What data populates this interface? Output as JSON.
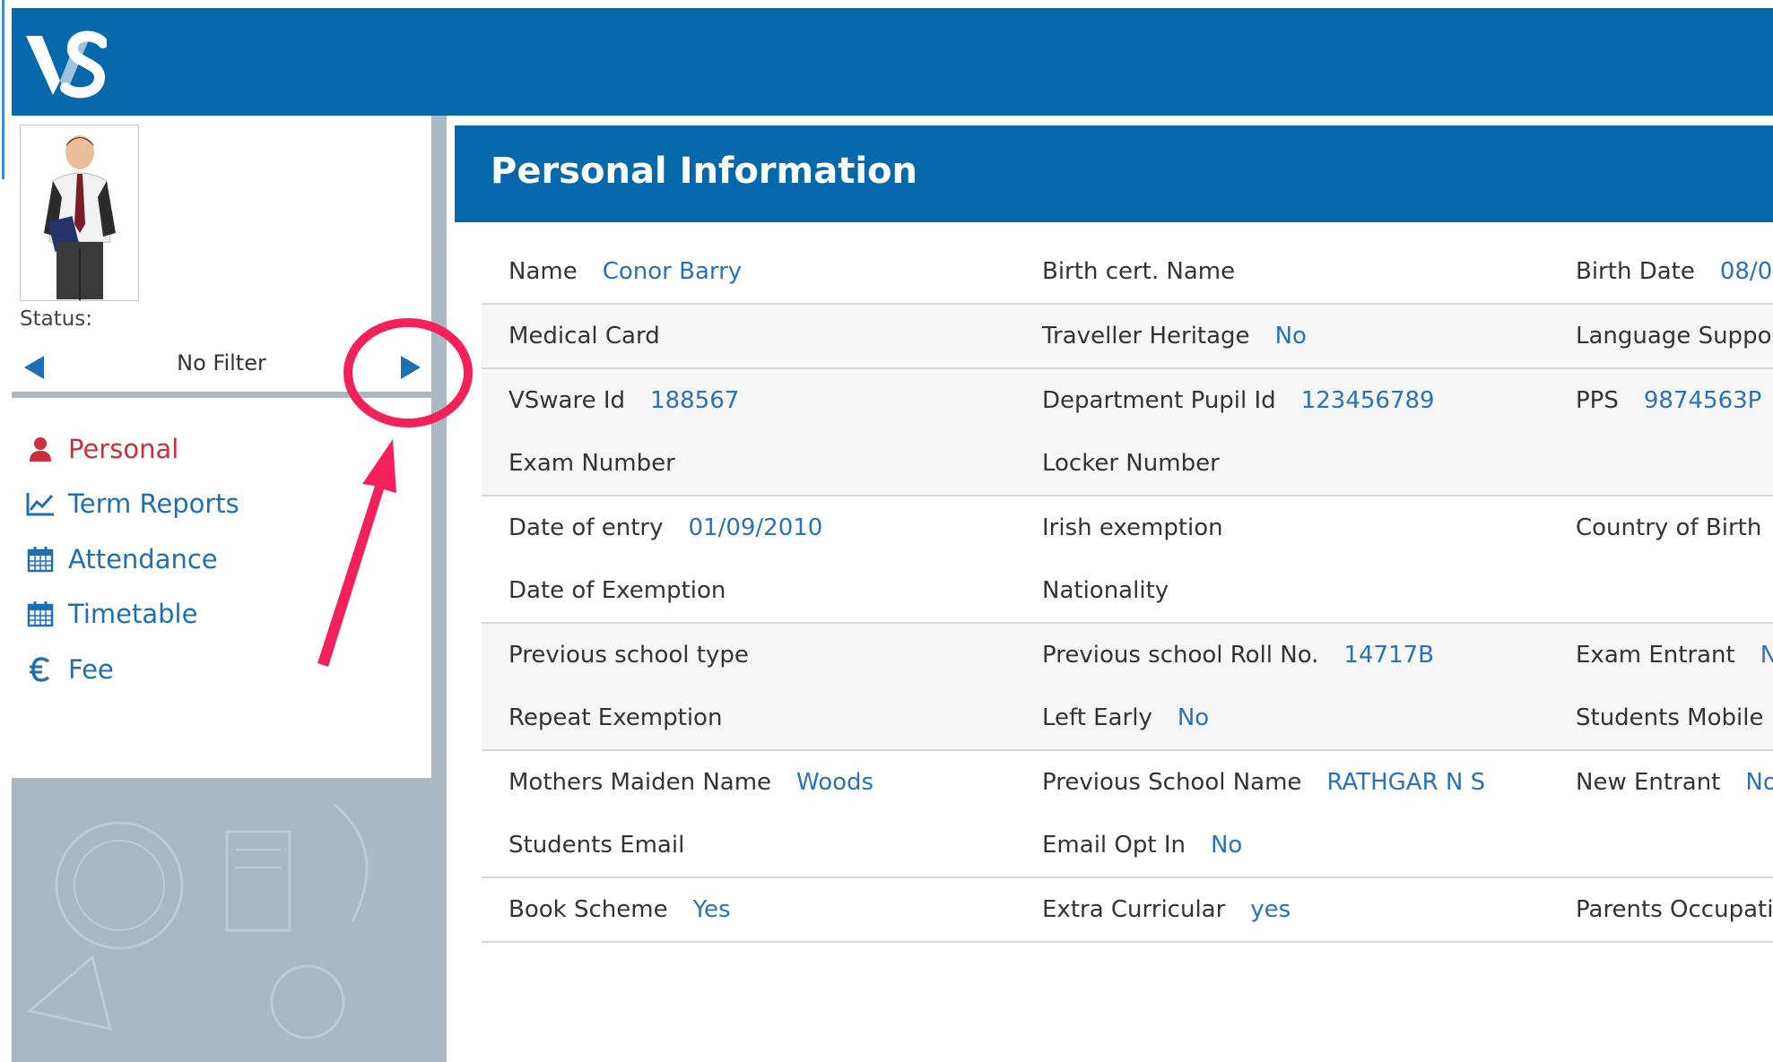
{
  "colors": {
    "brand_blue": "#0568ab",
    "link_blue": "#1f6fb0",
    "active_red": "#c8313c",
    "annotation_pink": "#f4205b"
  },
  "header": {
    "logo_text": "VS",
    "logo_icon": "vsware-logo"
  },
  "sidebar": {
    "status_label": "Status:",
    "filter": {
      "value": "No Filter",
      "prev_icon": "triangle-left-icon",
      "next_icon": "triangle-right-icon"
    },
    "menu": [
      {
        "label": "Personal",
        "icon": "user-icon"
      },
      {
        "label": "Term Reports",
        "icon": "line-chart-icon"
      },
      {
        "label": "Attendance",
        "icon": "calendar-icon"
      },
      {
        "label": "Timetable",
        "icon": "calendar-icon"
      },
      {
        "label": "Fee",
        "icon": "euro-icon"
      }
    ],
    "active_item": "Personal"
  },
  "main": {
    "title": "Personal Information",
    "rows": [
      [
        [
          {
            "label": "Name",
            "value": "Conor Barry"
          },
          {
            "label": "Birth cert. Name",
            "value": ""
          },
          {
            "label": "Birth Date",
            "value": "08/0"
          }
        ]
      ],
      [
        [
          {
            "label": "Medical Card",
            "value": ""
          },
          {
            "label": "Traveller Heritage",
            "value": "No"
          },
          {
            "label": "Language Support",
            "value": ""
          }
        ]
      ],
      [
        [
          {
            "label": "VSware Id",
            "value": "188567"
          },
          {
            "label": "Department Pupil Id",
            "value": "123456789"
          },
          {
            "label": "PPS",
            "value": "9874563P"
          }
        ],
        [
          {
            "label": "Exam Number",
            "value": ""
          },
          {
            "label": "Locker Number",
            "value": ""
          },
          {
            "label": "",
            "value": ""
          }
        ]
      ],
      [
        [
          {
            "label": "Date of entry",
            "value": "01/09/2010"
          },
          {
            "label": "Irish exemption",
            "value": ""
          },
          {
            "label": "Country of Birth",
            "value": ""
          }
        ],
        [
          {
            "label": "Date of Exemption",
            "value": ""
          },
          {
            "label": "Nationality",
            "value": ""
          },
          {
            "label": "",
            "value": ""
          }
        ]
      ],
      [
        [
          {
            "label": "Previous school type",
            "value": ""
          },
          {
            "label": "Previous school Roll No.",
            "value": "14717B"
          },
          {
            "label": "Exam Entrant",
            "value": "No"
          }
        ],
        [
          {
            "label": "Repeat Exemption",
            "value": ""
          },
          {
            "label": "Left Early",
            "value": "No"
          },
          {
            "label": "Students Mobile",
            "value": ""
          }
        ]
      ],
      [
        [
          {
            "label": "Mothers Maiden Name",
            "value": "Woods"
          },
          {
            "label": "Previous School Name",
            "value": "RATHGAR N S"
          },
          {
            "label": "New Entrant",
            "value": "No"
          }
        ],
        [
          {
            "label": "Students Email",
            "value": ""
          },
          {
            "label": "Email Opt In",
            "value": "No"
          },
          {
            "label": "",
            "value": ""
          }
        ]
      ],
      [
        [
          {
            "label": "Book Scheme",
            "value": "Yes"
          },
          {
            "label": "Extra Curricular",
            "value": "yes"
          },
          {
            "label": "Parents Occupation",
            "value": ""
          }
        ]
      ]
    ]
  }
}
